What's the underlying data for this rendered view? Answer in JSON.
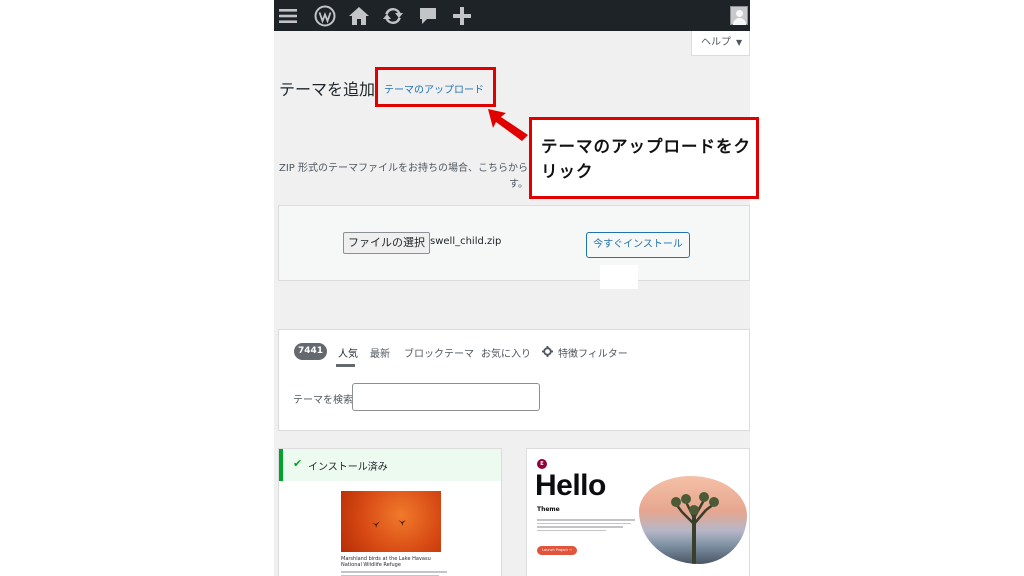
{
  "admin_bar": {
    "icons": [
      "menu-icon",
      "wordpress-logo-icon",
      "home-icon",
      "updates-icon",
      "comments-icon",
      "add-new-icon",
      "avatar"
    ]
  },
  "help_tab": {
    "label": "ヘルプ",
    "caret": "▼"
  },
  "header": {
    "title": "テーマを追加",
    "upload_link": "テーマのアップロード"
  },
  "upload": {
    "description": "ZIP 形式のテーマファイルをお持ちの場合、こちらから す。",
    "choose_file_label": "ファイルの選択",
    "file_name": "swell_child.zip",
    "install_button": "今すぐインストール"
  },
  "filter": {
    "count": "7441",
    "tabs": [
      "人気",
      "最新",
      "ブロックテーマ",
      "お気に入り"
    ],
    "active_tab": "人気",
    "feature_filter_label": "特徴フィルター",
    "search_label": "テーマを検索",
    "search_value": ""
  },
  "themes": {
    "installed_label": "インストール済み",
    "installed_caption": "Marshland birds at the Lake Havasu National Wildlife Refuge",
    "hello": {
      "logo": "E",
      "title": "Hello",
      "subtitle": "Theme",
      "button": "Launch Project →"
    }
  },
  "annotation": {
    "callout_text": "テーマのアップロードをクリック",
    "accent_color": "#e00000"
  },
  "colors": {
    "admin_bar_bg": "#1d2327",
    "link_blue": "#2271b1",
    "installed_green": "#00a32a"
  }
}
